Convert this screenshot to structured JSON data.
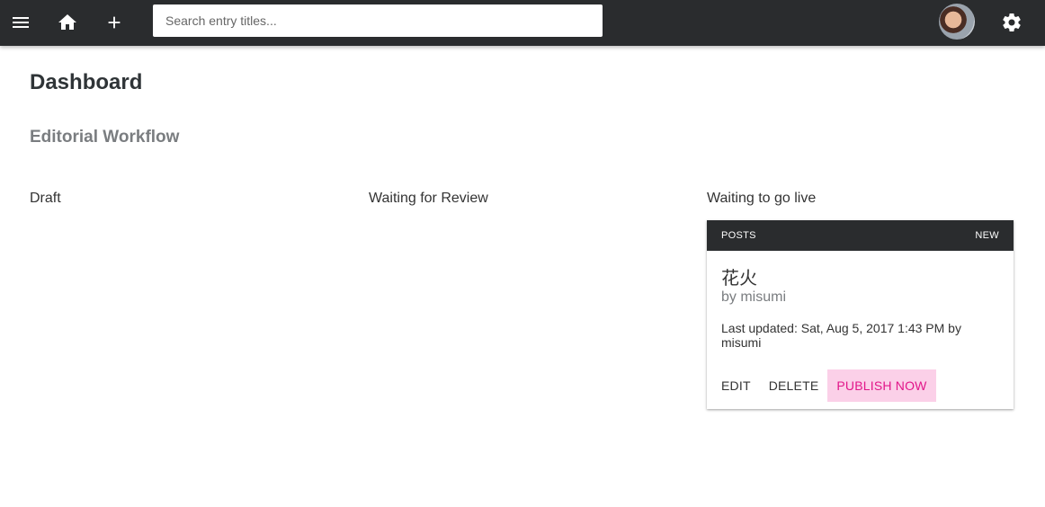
{
  "topbar": {
    "menu_icon": "hamburger-menu-icon",
    "home_icon": "home-icon",
    "add_icon": "plus-icon",
    "settings_icon": "gear-icon",
    "search": {
      "placeholder": "Search entry titles...",
      "value": ""
    },
    "colors": {
      "background": "#2a2c2e",
      "icon": "#ffffff"
    }
  },
  "page": {
    "title": "Dashboard",
    "section_title": "Editorial Workflow"
  },
  "columns": [
    {
      "title": "Draft"
    },
    {
      "title": "Waiting for Review"
    },
    {
      "title": "Waiting to go live"
    }
  ],
  "card": {
    "collection": "POSTS",
    "status": "NEW",
    "title": "花火",
    "author": "by misumi",
    "updated": "Last updated: Sat, Aug 5, 2017 1:43 PM by misumi",
    "actions": {
      "edit": "EDIT",
      "delete": "DELETE",
      "publish": "PUBLISH NOW"
    },
    "colors": {
      "publish_bg": "#fbd0e8",
      "publish_text": "#e2168a"
    }
  }
}
